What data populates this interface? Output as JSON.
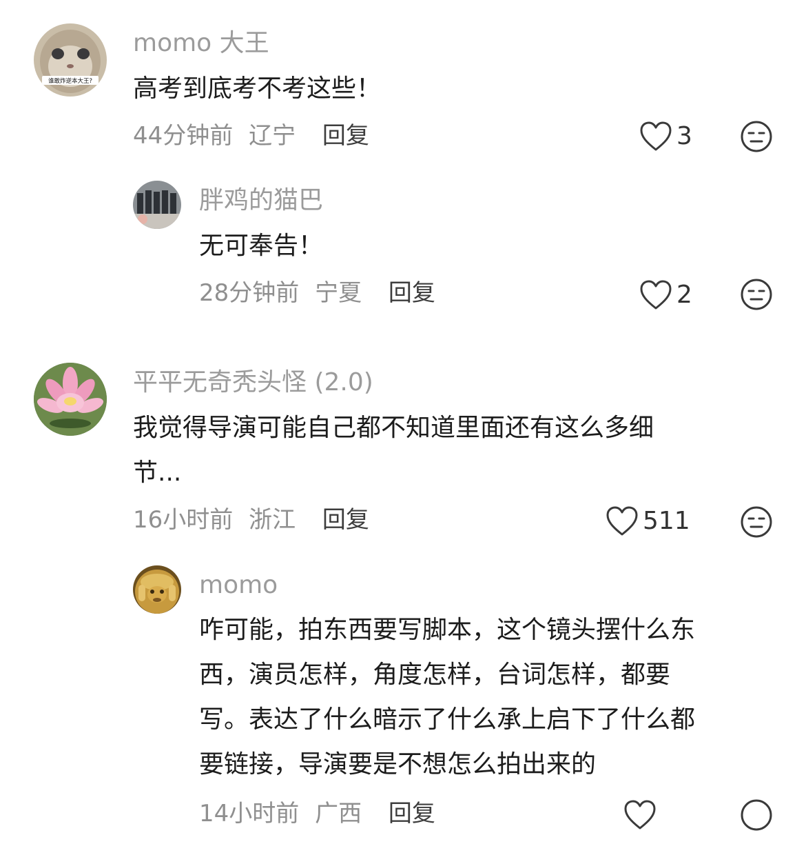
{
  "comments": [
    {
      "user": "momo 大王",
      "avatar_icon": "cat-face-avatar",
      "avatar_caption": "谁敢炸逆本大王?",
      "text": "高考到底考不考这些！",
      "time": "44分钟前",
      "location": "辽宁",
      "reply_label": "回复",
      "likes": "3",
      "replies": [
        {
          "user": "胖鸡的猫巴",
          "avatar_icon": "group-silhouette-avatar",
          "text": "无可奉告！",
          "time": "28分钟前",
          "location": "宁夏",
          "reply_label": "回复",
          "likes": "2"
        }
      ]
    },
    {
      "user": "平平无奇秃头怪 (2.0)",
      "avatar_icon": "pink-lotus-avatar",
      "text_lines": [
        "我觉得导演可能自己都不知道里面还有这么多细",
        "节..."
      ],
      "time": "16小时前",
      "location": "浙江",
      "reply_label": "回复",
      "likes": "511",
      "replies": [
        {
          "user": "momo",
          "avatar_icon": "golden-monkey-avatar",
          "text_lines": [
            "咋可能，拍东西要写脚本，这个镜头摆什么东",
            "西，演员怎样，角度怎样，台词怎样，都要",
            "写。表达了什么暗示了什么承上启下了什么都",
            "要链接，导演要是不想怎么拍出来的"
          ],
          "time": "14小时前",
          "location": "广西",
          "reply_label": "回复",
          "likes": "",
          "likes_cropped": true
        }
      ]
    }
  ],
  "icons": {
    "like": "heart-outline-icon",
    "reaction": "meh-face-icon"
  },
  "colors": {
    "username": "#9b9b9b",
    "body_text": "#1c1c1c",
    "meta": "#8f8f8f",
    "icon_stroke": "#3a3a3a"
  }
}
